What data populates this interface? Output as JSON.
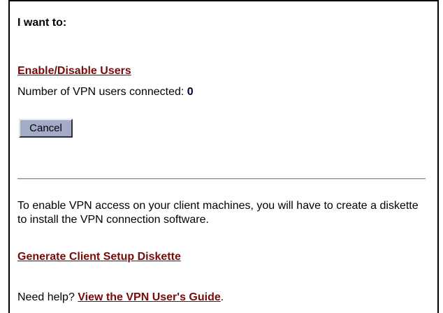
{
  "panel": {
    "heading": "I want to:",
    "enable_disable_link": "Enable/Disable Users",
    "vpn_users_label": "Number of VPN users connected: ",
    "vpn_users_count": "0",
    "cancel_label": "Cancel",
    "info_text": "To enable VPN access on your client machines, you will have to create a diskette to install the VPN connection software.",
    "generate_link": "Generate Client Setup Diskette",
    "help_prefix": "Need help? ",
    "help_link": "View the VPN User's Guide",
    "help_suffix": "."
  },
  "colors": {
    "link": "#7a0a0a",
    "button_face": "#a3abc6",
    "border": "#000000"
  }
}
